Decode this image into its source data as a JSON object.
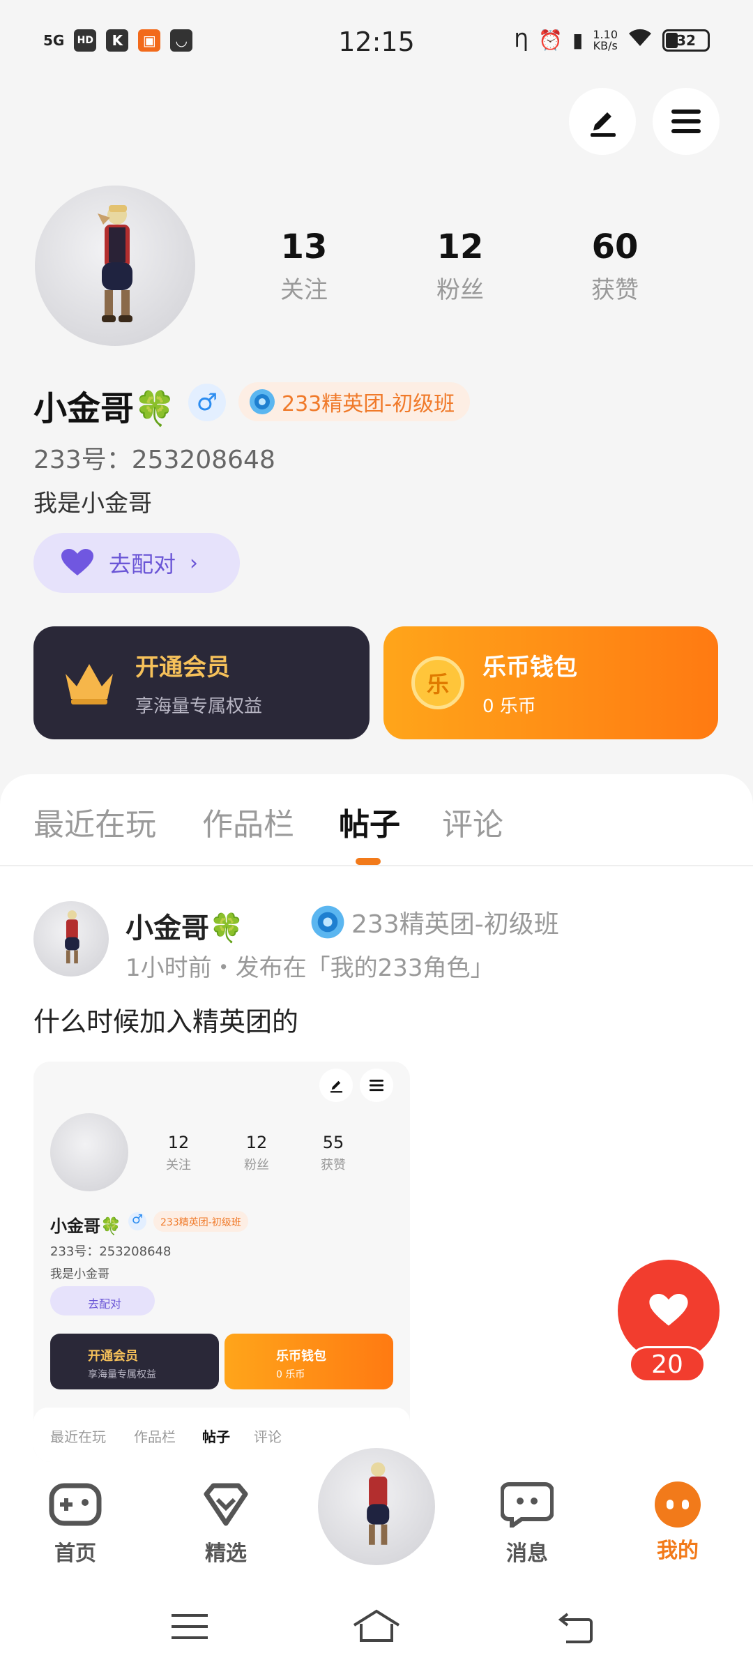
{
  "status_bar": {
    "time": "12:15",
    "network": "5G",
    "hd": "HD",
    "speed_value": "1.10",
    "speed_unit": "KB/s",
    "battery": "32"
  },
  "profile": {
    "stats": [
      {
        "value": "13",
        "label": "关注"
      },
      {
        "value": "12",
        "label": "粉丝"
      },
      {
        "value": "60",
        "label": "获赞"
      }
    ],
    "name": "小金哥🍀",
    "gender_symbol": "♂",
    "badge": "233精英团-初级班",
    "uid": "233号：253208648",
    "bio": "我是小金哥",
    "pair_label": "去配对"
  },
  "cards": {
    "vip": {
      "title": "开通会员",
      "subtitle": "享海量专属权益",
      "icon_text": ""
    },
    "wallet": {
      "title": "乐币钱包",
      "subtitle": "0 乐币",
      "icon_text": "乐"
    }
  },
  "tabs": [
    "最近在玩",
    "作品栏",
    "帖子",
    "评论"
  ],
  "post": {
    "author": "小金哥🍀",
    "badge": "233精英团-初级班",
    "meta": "1小时前・发布在「我的233角色」",
    "text": "什么时候加入精英团的",
    "image": {
      "stats": [
        {
          "value": "12",
          "label": "关注"
        },
        {
          "value": "12",
          "label": "粉丝"
        },
        {
          "value": "55",
          "label": "获赞"
        }
      ],
      "name": "小金哥🍀",
      "badge": "233精英团-初级班",
      "uid": "233号：253208648",
      "bio": "我是小金哥",
      "pair_label": "去配对",
      "vip_title": "开通会员",
      "vip_sub": "享海量专属权益",
      "wallet_title": "乐币钱包",
      "wallet_sub": "0 乐币",
      "tabs": [
        "最近在玩",
        "作品栏",
        "帖子",
        "评论"
      ]
    }
  },
  "like_count": "20",
  "nav": [
    {
      "label": "首页",
      "icon": "gamepad-icon"
    },
    {
      "label": "精选",
      "icon": "heart-gem-icon"
    },
    {
      "label": "",
      "icon": "avatar"
    },
    {
      "label": "消息",
      "icon": "chat-icon"
    },
    {
      "label": "我的",
      "icon": "me-icon"
    }
  ],
  "colors": {
    "accent": "#f27a1a",
    "like": "#f23d2e",
    "vip_card": "#2a2838",
    "wallet_card": "#ff8a12",
    "pair": "#6a55d6"
  }
}
